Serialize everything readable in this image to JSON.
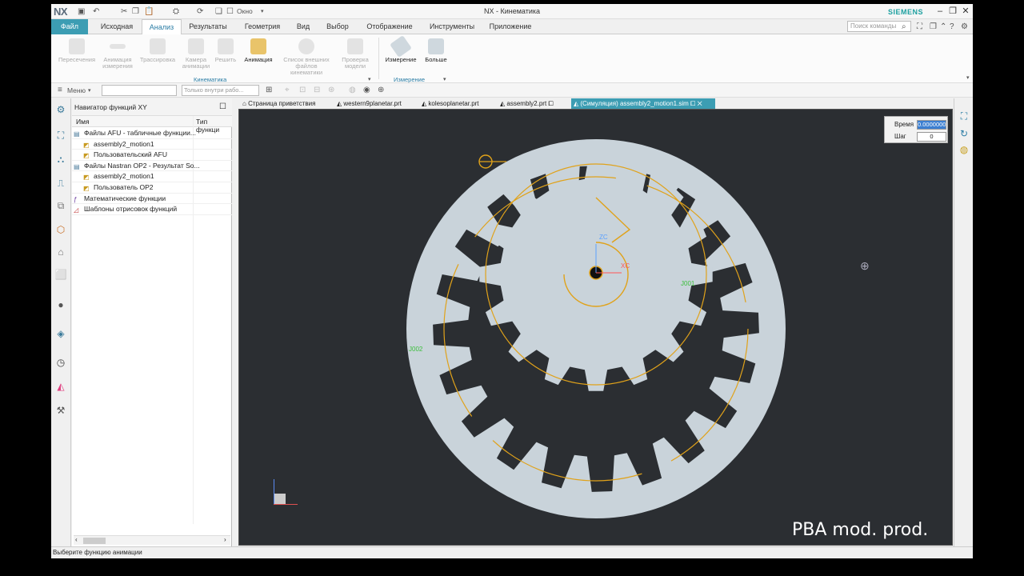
{
  "title": {
    "app_logo": "NX",
    "window_title": "NX - Кинематика",
    "brand": "SIEMENS",
    "window_menu": "Окно"
  },
  "tabs": [
    {
      "label": "Файл"
    },
    {
      "label": "Исходная"
    },
    {
      "label": "Анализ"
    },
    {
      "label": "Результаты"
    },
    {
      "label": "Геометрия"
    },
    {
      "label": "Вид"
    },
    {
      "label": "Выбор"
    },
    {
      "label": "Отображение"
    },
    {
      "label": "Инструменты"
    },
    {
      "label": "Приложение"
    }
  ],
  "search": {
    "placeholder": "Поиск команды"
  },
  "ribbon": {
    "kinematics_buttons": [
      {
        "label": "Пересечения"
      },
      {
        "label": "Анимация измерения"
      },
      {
        "label": "Трассировка"
      },
      {
        "label": "Камера анимации"
      },
      {
        "label": "Решить"
      },
      {
        "label": "Анимация"
      },
      {
        "label": "Список внешних файлов кинематики"
      },
      {
        "label": "Проверка модели"
      }
    ],
    "kinematics_group": "Кинематика",
    "measure_buttons": [
      {
        "label": "Измерение"
      },
      {
        "label": "Больше"
      }
    ],
    "measure_group": "Измерение"
  },
  "toolbar": {
    "menu_label": "Меню",
    "filter_value": "",
    "scope_value": "Только внутри рабо..."
  },
  "navigator": {
    "title": "Навигатор функций XY",
    "col_name": "Имя",
    "col_type": "Тип функци",
    "items": [
      {
        "label": "Файлы AFU - табличные функции...",
        "level": 0,
        "icon": "afu-folder-icon"
      },
      {
        "label": "assembly2_motion1",
        "level": 1,
        "icon": "afu-file-icon"
      },
      {
        "label": "Пользовательский AFU",
        "level": 1,
        "icon": "afu-file-icon"
      },
      {
        "label": "Файлы Nastran OP2 - Результат So...",
        "level": 0,
        "icon": "op2-folder-icon"
      },
      {
        "label": "assembly2_motion1",
        "level": 1,
        "icon": "op2-file-icon"
      },
      {
        "label": "Пользователь OP2",
        "level": 1,
        "icon": "op2-file-icon"
      },
      {
        "label": "Математические функции",
        "level": 0,
        "icon": "math-function-icon"
      },
      {
        "label": "Шаблоны отрисовок функций",
        "level": 0,
        "icon": "plot-template-icon"
      }
    ]
  },
  "doc_tabs": [
    {
      "label": "Страница приветствия"
    },
    {
      "label": "western9planetar.prt"
    },
    {
      "label": "kolesoplanetar.prt"
    },
    {
      "label": "assembly2.prt"
    },
    {
      "label": "(Симуляция) assembly2_motion1.sim"
    }
  ],
  "viewport": {
    "time_label": "Время",
    "time_value": "0.0000000",
    "step_label": "Шаг",
    "step_value": "0",
    "label_zc": "ZC",
    "label_xc": "XC",
    "label_j001": "J001",
    "label_j002": "J002",
    "outer_gear_teeth": 20,
    "inner_gear_teeth": 16,
    "gear_color": "#c9d3da",
    "curve_color": "#e0a21a"
  },
  "status": {
    "text": "Выберите функцию анимации"
  },
  "watermark": "PBA mod. prod."
}
